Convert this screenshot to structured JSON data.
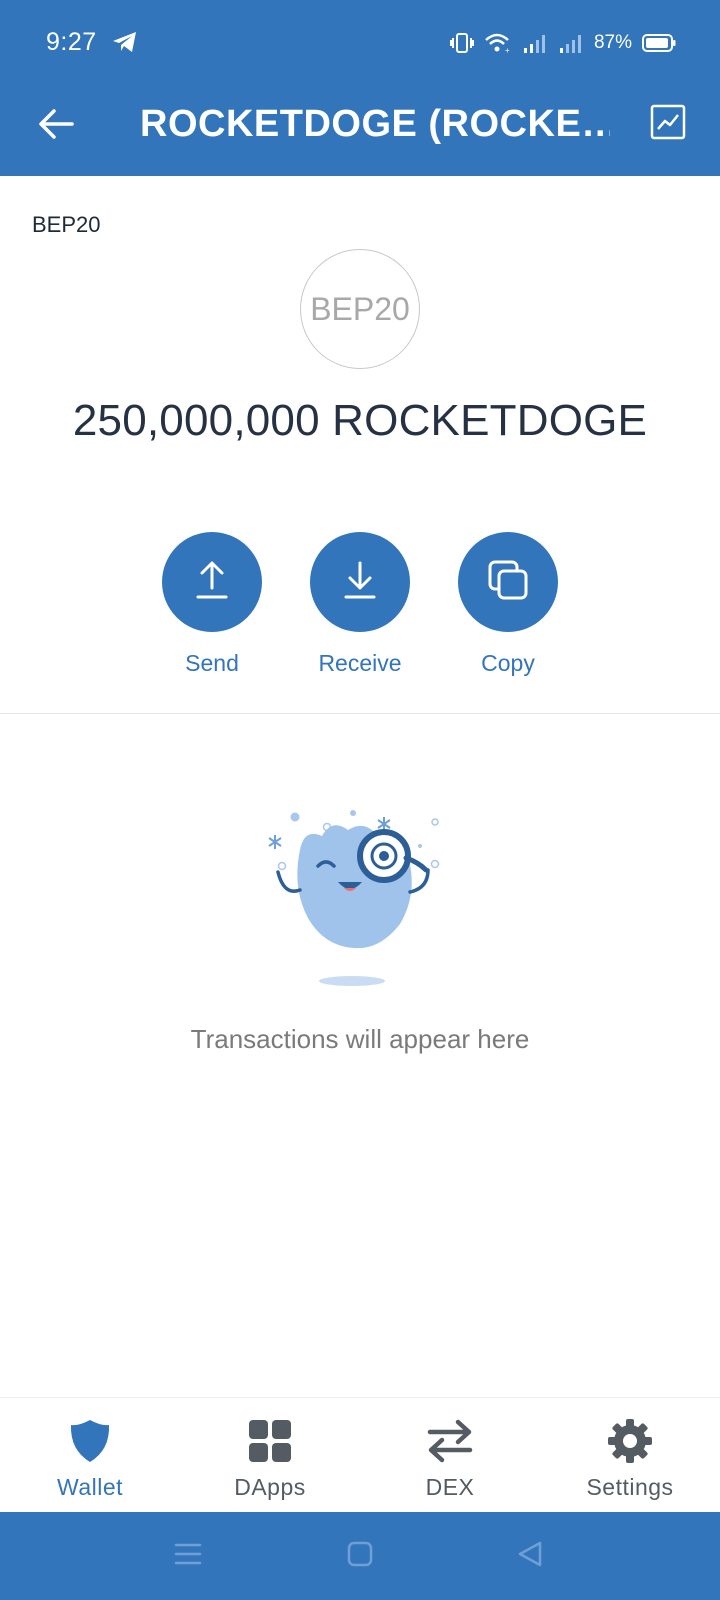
{
  "status_bar": {
    "time": "9:27",
    "battery_percent": "87%",
    "icons": [
      "telegram-icon",
      "vibrate-icon",
      "wifi-icon",
      "signal-icon",
      "signal-icon",
      "battery-icon"
    ]
  },
  "app_bar": {
    "title": "ROCKETDOGE (ROCKE…",
    "back_icon": "arrow-left-icon",
    "chart_icon": "chart-line-icon"
  },
  "token": {
    "network": "BEP20",
    "logo_text": "BEP20",
    "balance": "250,000,000 ROCKETDOGE"
  },
  "actions": [
    {
      "label": "Send",
      "icon": "upload-arrow-icon"
    },
    {
      "label": "Receive",
      "icon": "download-arrow-icon"
    },
    {
      "label": "Copy",
      "icon": "copy-icon"
    }
  ],
  "empty_state": {
    "message": "Transactions will appear here",
    "illustration": "mascot-magnifier-illustration"
  },
  "bottom_nav": [
    {
      "label": "Wallet",
      "icon": "shield-icon",
      "active": true
    },
    {
      "label": "DApps",
      "icon": "grid-icon",
      "active": false
    },
    {
      "label": "DEX",
      "icon": "swap-arrows-icon",
      "active": false
    },
    {
      "label": "Settings",
      "icon": "gear-icon",
      "active": false
    }
  ],
  "system_nav": [
    "menu-icon",
    "home-square-icon",
    "back-triangle-icon"
  ],
  "colors": {
    "primary": "#3375bb",
    "text_dark": "#263244",
    "text_muted": "#7a7a7a",
    "nav_inactive": "#555b62"
  }
}
